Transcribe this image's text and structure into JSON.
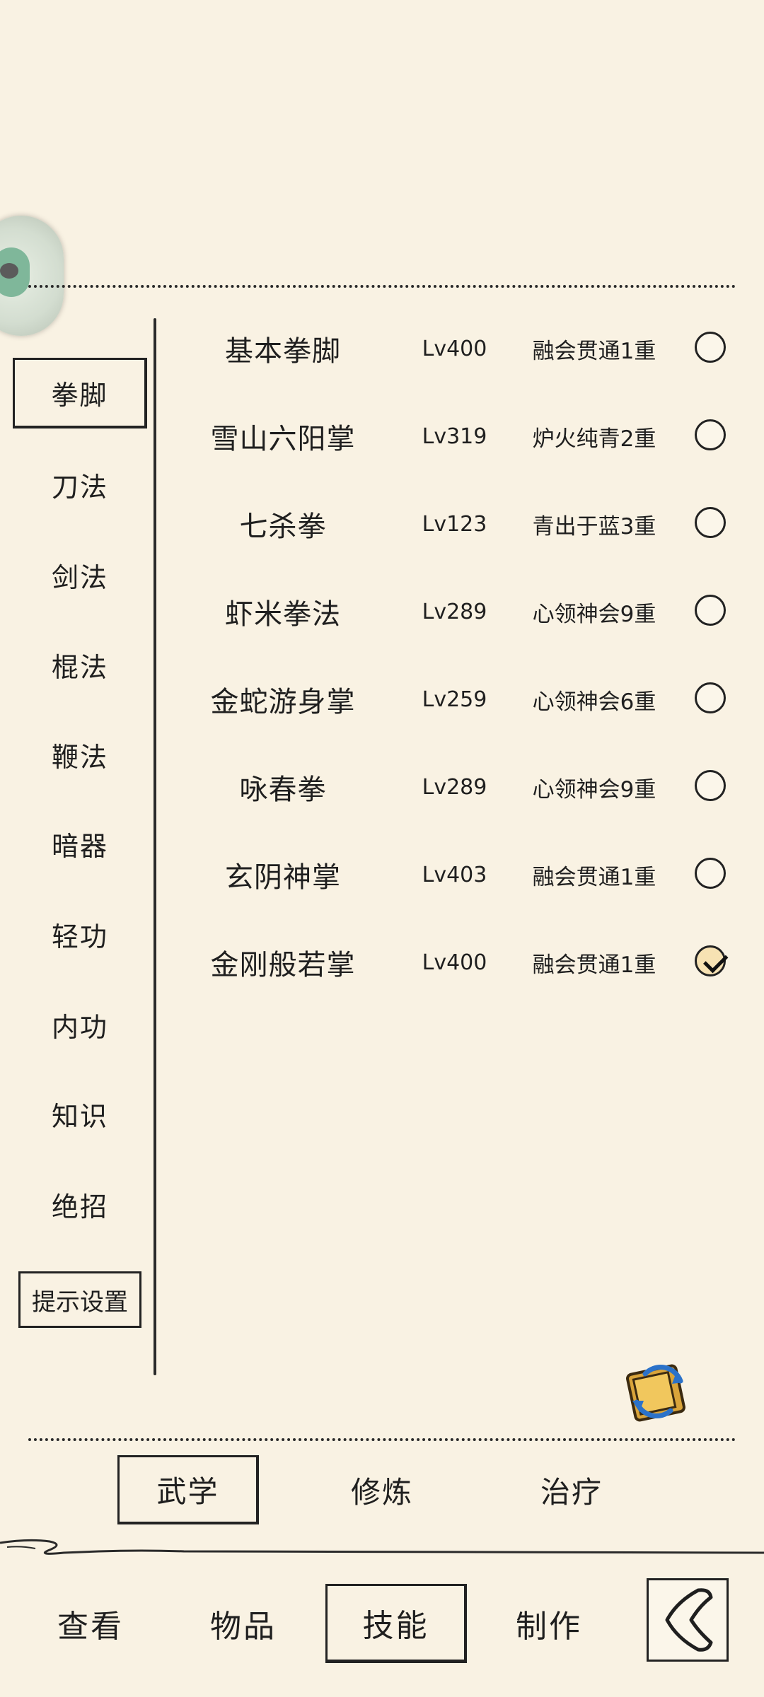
{
  "sidebar": {
    "items": [
      {
        "label": "拳脚",
        "active": true
      },
      {
        "label": "刀法",
        "active": false
      },
      {
        "label": "剑法",
        "active": false
      },
      {
        "label": "棍法",
        "active": false
      },
      {
        "label": "鞭法",
        "active": false
      },
      {
        "label": "暗器",
        "active": false
      },
      {
        "label": "轻功",
        "active": false
      },
      {
        "label": "内功",
        "active": false
      },
      {
        "label": "知识",
        "active": false
      },
      {
        "label": "绝招",
        "active": false
      }
    ],
    "hint_button": "提示设置"
  },
  "skills": [
    {
      "name": "基本拳脚",
      "level": "Lv400",
      "rank": "融会贯通1重",
      "selected": false
    },
    {
      "name": "雪山六阳掌",
      "level": "Lv319",
      "rank": "炉火纯青2重",
      "selected": false
    },
    {
      "name": "七杀拳",
      "level": "Lv123",
      "rank": "青出于蓝3重",
      "selected": false
    },
    {
      "name": "虾米拳法",
      "level": "Lv289",
      "rank": "心领神会9重",
      "selected": false
    },
    {
      "name": "金蛇游身掌",
      "level": "Lv259",
      "rank": "心领神会6重",
      "selected": false
    },
    {
      "name": "咏春拳",
      "level": "Lv289",
      "rank": "心领神会9重",
      "selected": false
    },
    {
      "name": "玄阴神掌",
      "level": "Lv403",
      "rank": "融会贯通1重",
      "selected": false
    },
    {
      "name": "金刚般若掌",
      "level": "Lv400",
      "rank": "融会贯通1重",
      "selected": true
    }
  ],
  "subtabs": [
    {
      "label": "武学",
      "active": true
    },
    {
      "label": "修炼",
      "active": false
    },
    {
      "label": "治疗",
      "active": false
    }
  ],
  "nav": [
    {
      "label": "查看",
      "active": false
    },
    {
      "label": "物品",
      "active": false
    },
    {
      "label": "技能",
      "active": true
    },
    {
      "label": "制作",
      "active": false
    }
  ],
  "icons": {
    "assistant": "assistant-orb-icon",
    "book_swap": "book-swap-icon",
    "back": "back-arrow-icon"
  }
}
